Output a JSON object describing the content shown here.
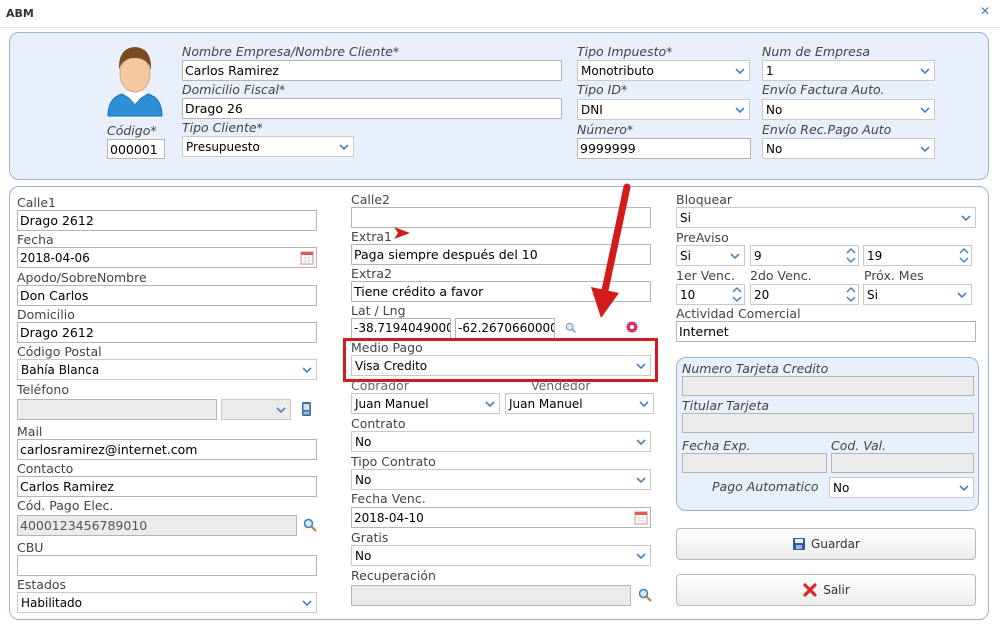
{
  "window": {
    "title": "ABM",
    "close_icon": "close-icon"
  },
  "header": {
    "codigo_label": "Código*",
    "codigo_value": "000001",
    "nombre_label": "Nombre Empresa/Nombre Cliente*",
    "nombre_value": "Carlos Ramirez",
    "domicilio_label": "Domicilio Fiscal*",
    "domicilio_value": "Drago 26",
    "tipo_cliente_label": "Tipo Cliente*",
    "tipo_cliente_value": "Presupuesto",
    "tipo_impuesto_label": "Tipo Impuesto*",
    "tipo_impuesto_value": "Monotributo",
    "tipo_id_label": "Tipo ID*",
    "tipo_id_value": "DNI",
    "numero_label": "Número*",
    "numero_value": "9999999",
    "num_empresa_label": "Num de Empresa",
    "num_empresa_value": "1",
    "envio_factura_label": "Envío Factura Auto.",
    "envio_factura_value": "No",
    "envio_recpago_label": "Envío Rec.Pago Auto",
    "envio_recpago_value": "No"
  },
  "col1": {
    "calle1_label": "Calle1",
    "calle1_value": "Drago 2612",
    "fecha_label": "Fecha",
    "fecha_value": "2018-04-06",
    "apodo_label": "Apodo/SobreNombre",
    "apodo_value": "Don Carlos",
    "domicilio_label": "Domicilio",
    "domicilio_value": "Drago 2612",
    "cp_label": "Código Postal",
    "cp_value": "Bahía Blanca",
    "telefono_label": "Teléfono",
    "telefono_value": "",
    "mail_label": "Mail",
    "mail_value": "carlosramirez@internet.com",
    "contacto_label": "Contacto",
    "contacto_value": "Carlos Ramirez",
    "cod_pago_label": "Cód. Pago Elec.",
    "cod_pago_value": "4000123456789010",
    "cbu_label": "CBU",
    "cbu_value": "",
    "estados_label": "Estados",
    "estados_value": "Habilitado"
  },
  "col2": {
    "calle2_label": "Calle2",
    "calle2_value": "",
    "extra1_label": "Extra1",
    "extra1_value": "Paga siempre después del 10",
    "extra2_label": "Extra2",
    "extra2_value": "Tiene crédito a favor",
    "latlng_label": "Lat / Lng",
    "lat_value": "-38.7194049000",
    "lng_value": "-62.2670660000",
    "medio_pago_label": "Medio Pago",
    "medio_pago_value": "Visa Credito",
    "cobrador_label": "Cobrador",
    "cobrador_value": "Juan Manuel",
    "vendedor_label": "Vendedor",
    "vendedor_value": "Juan Manuel",
    "contrato_label": "Contrato",
    "contrato_value": "No",
    "tipo_contrato_label": "Tipo Contrato",
    "tipo_contrato_value": "No",
    "fecha_venc_label": "Fecha Venc.",
    "fecha_venc_value": "2018-04-10",
    "gratis_label": "Gratis",
    "gratis_value": "No",
    "recuperacion_label": "Recuperación",
    "recuperacion_value": ""
  },
  "col3": {
    "bloquear_label": "Bloquear",
    "bloquear_value": "Si",
    "preaviso_label": "PreAviso",
    "preaviso_value": "Si",
    "preaviso_num1": "9",
    "preaviso_num2": "19",
    "primer_venc_label": "1er Venc.",
    "primer_venc_value": "10",
    "segundo_venc_label": "2do Venc.",
    "segundo_venc_value": "20",
    "prox_mes_label": "Próx. Mes",
    "prox_mes_value": "Si",
    "actividad_label": "Actividad Comercial",
    "actividad_value": "Internet",
    "tarjeta": {
      "numero_label": "Numero Tarjeta Credito",
      "numero_value": "",
      "titular_label": "Titular Tarjeta",
      "titular_value": "",
      "fecha_exp_label": "Fecha Exp.",
      "fecha_exp_value": "",
      "cod_val_label": "Cod. Val.",
      "cod_val_value": "",
      "pago_auto_label": "Pago Automatico",
      "pago_auto_value": "No"
    },
    "guardar_label": "Guardar",
    "salir_label": "Salir"
  },
  "colors": {
    "accent_red": "#d21c1c",
    "panel_bg": "#e8f0fc",
    "panel_border": "#99b4d4"
  }
}
